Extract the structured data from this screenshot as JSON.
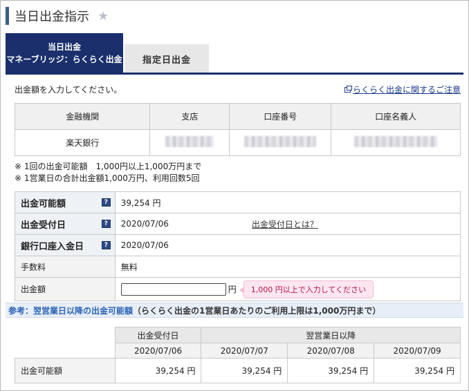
{
  "page": {
    "title": "当日出金指示"
  },
  "tabs": {
    "active_line1": "当日出金",
    "active_line2": "マネーブリッジ：らくらく出金",
    "inactive": "指定日出金"
  },
  "instruction": "出金額を入力してください。",
  "help_link": "らくらく出金に関するご注意",
  "bank_table": {
    "headers": [
      "金融機関",
      "支店",
      "口座番号",
      "口座名義人"
    ],
    "bank_name": "楽天銀行"
  },
  "notes": [
    "※ 1回の出金可能額　1,000円以上1,000万円まで",
    "※ 1営業日の合計出金額1,000万円、利用回数5回"
  ],
  "info": {
    "available_label": "出金可能額",
    "available_value": "39,254 円",
    "receipt_label": "出金受付日",
    "receipt_value": "2020/07/06",
    "receipt_link": "出金受付日とは？",
    "deposit_label": "銀行口座入金日",
    "deposit_value": "2020/07/06",
    "fee_label": "手数料",
    "fee_value": "無料",
    "amount_label": "出金額",
    "amount_unit": "円",
    "amount_value": "",
    "amount_tooltip": "1,000 円以上で入力してください"
  },
  "section": {
    "prefix": "参考：翌営業日以降の出金可能額",
    "suffix": "（らくらく出金の1営業日あたりのご利用上限は1,000万円まで）"
  },
  "future": {
    "col1_header": "出金受付日",
    "col2_header": "翌営業日以降",
    "dates": [
      "2020/07/06",
      "2020/07/07",
      "2020/07/08",
      "2020/07/09"
    ],
    "row_label": "出金可能額",
    "values": [
      "39,254 円",
      "39,254 円",
      "39,254 円",
      "39,254 円"
    ]
  },
  "colors": {
    "navy": "#1a2f6b",
    "link": "#2b63b5",
    "tooltip_bg": "#fde6ef",
    "tooltip_text": "#b0154a"
  },
  "icons": [
    "star-icon",
    "external-link-icon",
    "help-icon"
  ]
}
